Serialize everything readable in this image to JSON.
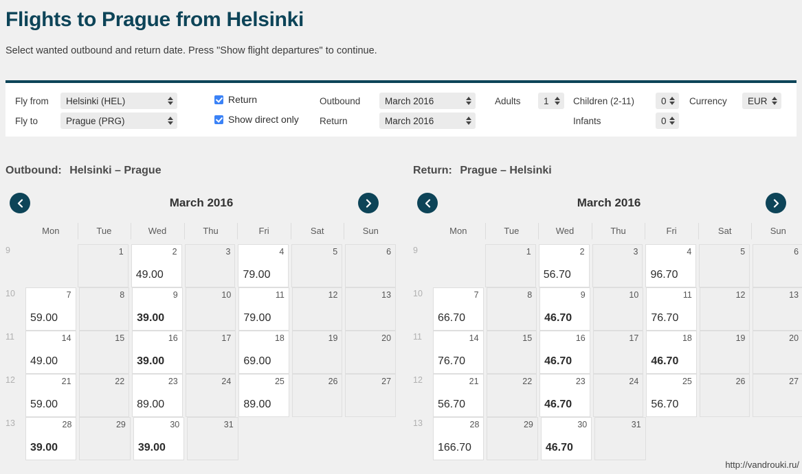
{
  "header": {
    "title": "Flights to Prague from Helsinki",
    "subtitle": "Select wanted outbound and return date. Press \"Show flight departures\" to continue."
  },
  "theme": {
    "accent": "#0d4458",
    "checkbox": "#3b82f6",
    "page_bg": "#f0f0f0",
    "panel_bg": "#ffffff"
  },
  "form": {
    "fly_from_label": "Fly from",
    "fly_from_value": "Helsinki (HEL)",
    "fly_to_label": "Fly to",
    "fly_to_value": "Prague (PRG)",
    "return_checkbox_label": "Return",
    "return_checked": true,
    "direct_checkbox_label": "Show direct only",
    "direct_checked": true,
    "outbound_label": "Outbound",
    "outbound_value": "March 2016",
    "return_label": "Return",
    "return_value": "March 2016",
    "adults_label": "Adults",
    "adults_value": "1",
    "children_label": "Children (2-11)",
    "children_value": "0",
    "infants_label": "Infants",
    "infants_value": "0",
    "currency_label": "Currency",
    "currency_value": "EUR"
  },
  "weekdays": [
    "Mon",
    "Tue",
    "Wed",
    "Thu",
    "Fri",
    "Sat",
    "Sun"
  ],
  "calendars": {
    "outbound": {
      "heading": "Outbound:",
      "route": "Helsinki – Prague",
      "month": "March 2016",
      "weeks": [
        {
          "num": "9",
          "days": [
            {
              "day": "",
              "price": "",
              "blank": true
            },
            {
              "day": "1",
              "price": ""
            },
            {
              "day": "2",
              "price": "49.00"
            },
            {
              "day": "3",
              "price": ""
            },
            {
              "day": "4",
              "price": "79.00"
            },
            {
              "day": "5",
              "price": ""
            },
            {
              "day": "6",
              "price": ""
            }
          ]
        },
        {
          "num": "10",
          "days": [
            {
              "day": "7",
              "price": "59.00"
            },
            {
              "day": "8",
              "price": ""
            },
            {
              "day": "9",
              "price": "39.00",
              "cheap": true
            },
            {
              "day": "10",
              "price": ""
            },
            {
              "day": "11",
              "price": "79.00"
            },
            {
              "day": "12",
              "price": ""
            },
            {
              "day": "13",
              "price": ""
            }
          ]
        },
        {
          "num": "11",
          "days": [
            {
              "day": "14",
              "price": "49.00"
            },
            {
              "day": "15",
              "price": ""
            },
            {
              "day": "16",
              "price": "39.00",
              "cheap": true
            },
            {
              "day": "17",
              "price": ""
            },
            {
              "day": "18",
              "price": "69.00"
            },
            {
              "day": "19",
              "price": ""
            },
            {
              "day": "20",
              "price": ""
            }
          ]
        },
        {
          "num": "12",
          "days": [
            {
              "day": "21",
              "price": "59.00"
            },
            {
              "day": "22",
              "price": ""
            },
            {
              "day": "23",
              "price": "89.00"
            },
            {
              "day": "24",
              "price": ""
            },
            {
              "day": "25",
              "price": "89.00"
            },
            {
              "day": "26",
              "price": ""
            },
            {
              "day": "27",
              "price": ""
            }
          ]
        },
        {
          "num": "13",
          "days": [
            {
              "day": "28",
              "price": "39.00",
              "cheap": true
            },
            {
              "day": "29",
              "price": ""
            },
            {
              "day": "30",
              "price": "39.00",
              "cheap": true
            },
            {
              "day": "31",
              "price": ""
            },
            {
              "day": "",
              "price": "",
              "blank": true
            },
            {
              "day": "",
              "price": "",
              "blank": true
            },
            {
              "day": "",
              "price": "",
              "blank": true
            }
          ]
        }
      ]
    },
    "return": {
      "heading": "Return:",
      "route": "Prague – Helsinki",
      "month": "March 2016",
      "weeks": [
        {
          "num": "9",
          "days": [
            {
              "day": "",
              "price": "",
              "blank": true
            },
            {
              "day": "1",
              "price": ""
            },
            {
              "day": "2",
              "price": "56.70"
            },
            {
              "day": "3",
              "price": ""
            },
            {
              "day": "4",
              "price": "96.70"
            },
            {
              "day": "5",
              "price": ""
            },
            {
              "day": "6",
              "price": ""
            }
          ]
        },
        {
          "num": "10",
          "days": [
            {
              "day": "7",
              "price": "66.70"
            },
            {
              "day": "8",
              "price": ""
            },
            {
              "day": "9",
              "price": "46.70",
              "cheap": true
            },
            {
              "day": "10",
              "price": ""
            },
            {
              "day": "11",
              "price": "76.70"
            },
            {
              "day": "12",
              "price": ""
            },
            {
              "day": "13",
              "price": ""
            }
          ]
        },
        {
          "num": "11",
          "days": [
            {
              "day": "14",
              "price": "76.70"
            },
            {
              "day": "15",
              "price": ""
            },
            {
              "day": "16",
              "price": "46.70",
              "cheap": true
            },
            {
              "day": "17",
              "price": ""
            },
            {
              "day": "18",
              "price": "46.70",
              "cheap": true
            },
            {
              "day": "19",
              "price": ""
            },
            {
              "day": "20",
              "price": ""
            }
          ]
        },
        {
          "num": "12",
          "days": [
            {
              "day": "21",
              "price": "56.70"
            },
            {
              "day": "22",
              "price": ""
            },
            {
              "day": "23",
              "price": "46.70",
              "cheap": true
            },
            {
              "day": "24",
              "price": ""
            },
            {
              "day": "25",
              "price": "56.70"
            },
            {
              "day": "26",
              "price": ""
            },
            {
              "day": "27",
              "price": ""
            }
          ]
        },
        {
          "num": "13",
          "days": [
            {
              "day": "28",
              "price": "166.70"
            },
            {
              "day": "29",
              "price": ""
            },
            {
              "day": "30",
              "price": "46.70",
              "cheap": true
            },
            {
              "day": "31",
              "price": ""
            },
            {
              "day": "",
              "price": "",
              "blank": true
            },
            {
              "day": "",
              "price": "",
              "blank": true
            },
            {
              "day": "",
              "price": "",
              "blank": true
            }
          ]
        }
      ]
    }
  },
  "watermark": "http://vandrouki.ru/"
}
